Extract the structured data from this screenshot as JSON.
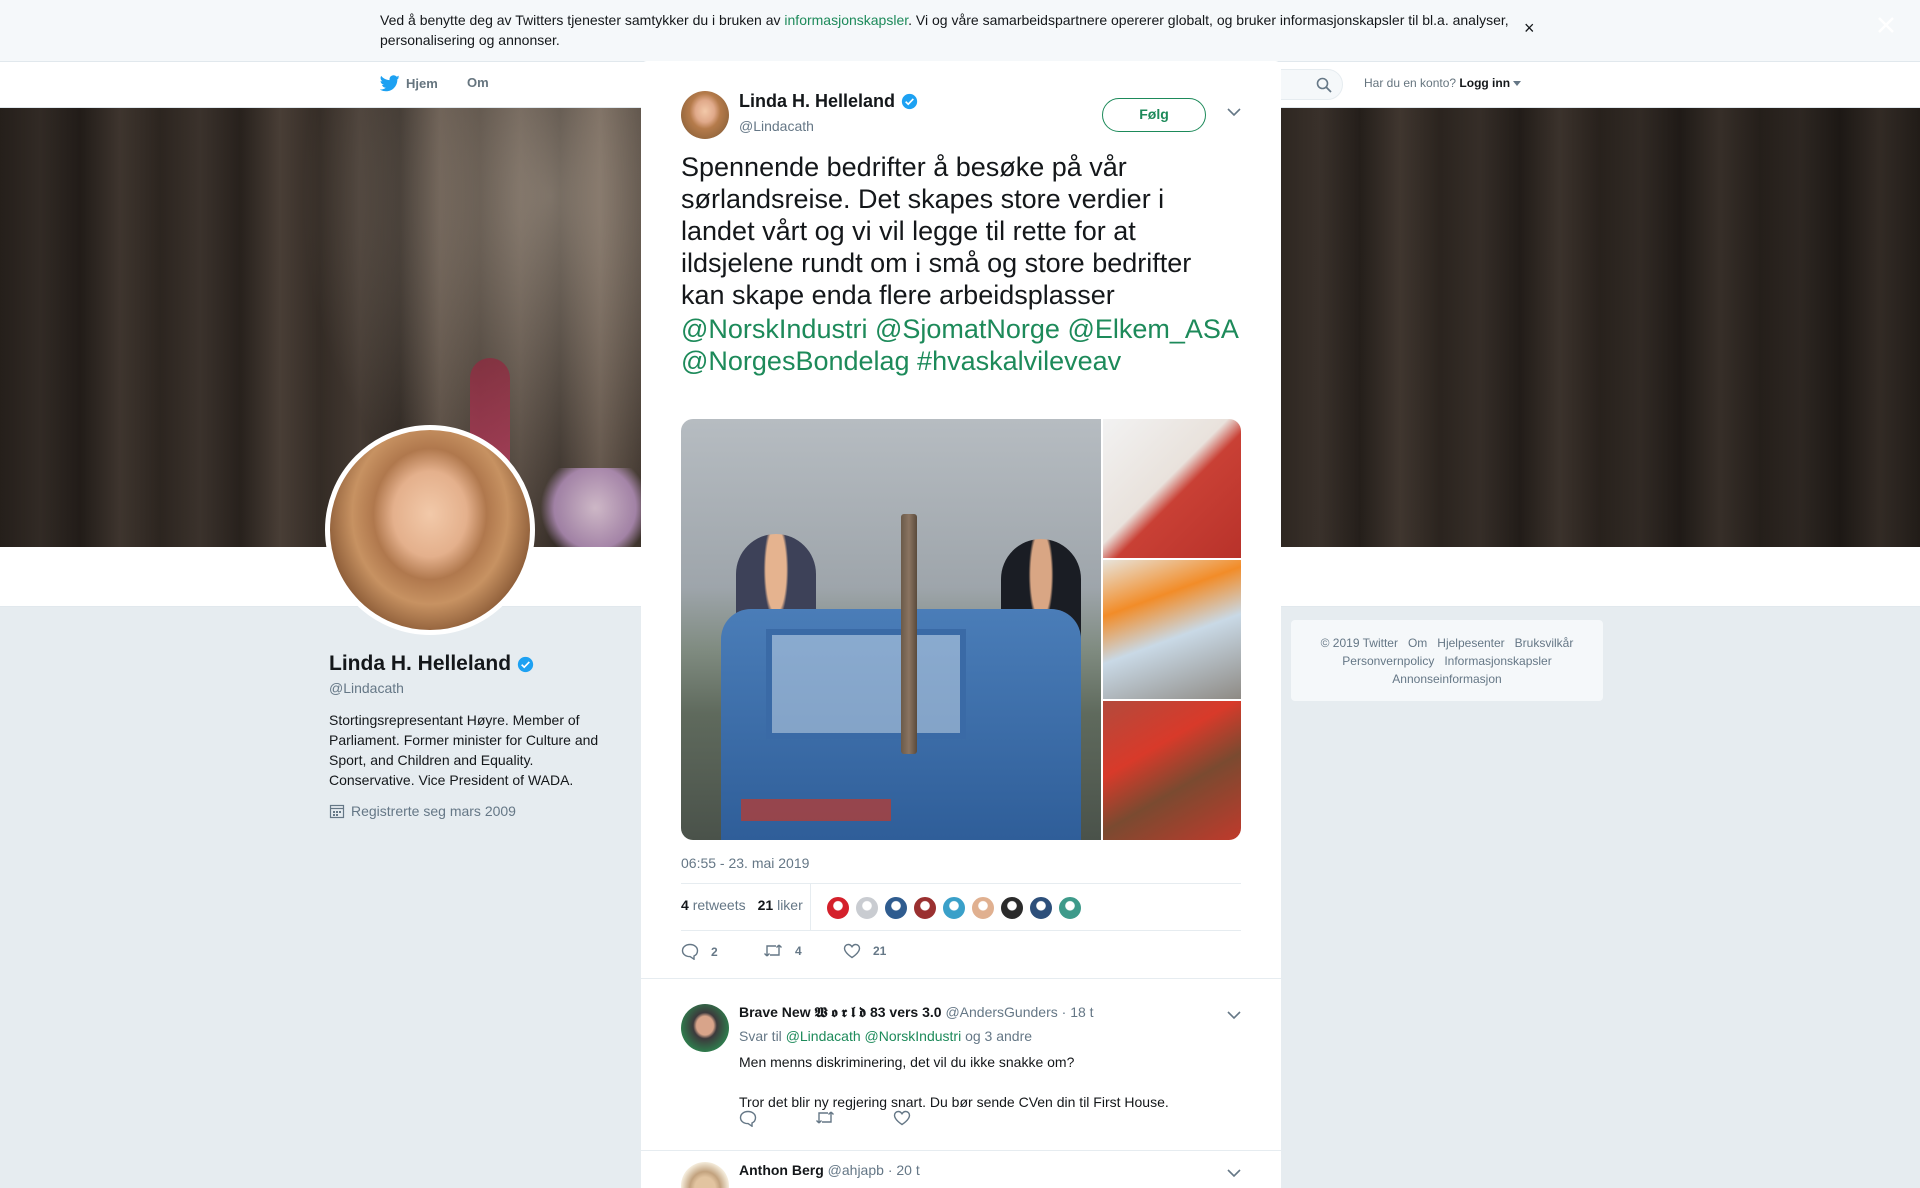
{
  "cookie": {
    "text_before": "Ved å benytte deg av Twitters tjenester samtykker du i bruken av ",
    "link": "informasjonskapsler",
    "text_after": ". Vi og våre samarbeidspartnere opererer globalt, og bruker informasjonskapsler til bl.a. analyser, personalisering og annonser.",
    "close": "×"
  },
  "nav": {
    "home": "Hjem",
    "about": "Om",
    "account_prompt": "Har du en konto?",
    "login": "Logg inn"
  },
  "modal_close": "×",
  "profile": {
    "name": "Linda H. Helleland",
    "handle": "@Lindacath",
    "bio": "Stortingsrepresentant Høyre. Member of Parliament. Former minister for Culture and Sport, and Children and Equality. Conservative. Vice President of WADA.",
    "joined": "Registrerte seg mars 2009"
  },
  "footer": {
    "links": [
      "© 2019 Twitter",
      "Om",
      "Hjelpesenter",
      "Bruksvilkår",
      "Personvernpolicy",
      "Informasjonskapsler",
      "Annonseinformasjon"
    ]
  },
  "tweet": {
    "name": "Linda H. Helleland",
    "handle": "@Lindacath",
    "follow": "Følg",
    "text": "Spennende bedrifter å besøke på vår sørlandsreise. Det skapes store verdier i landet vårt og vi vil legge til rette for at ildsjelene rundt om i små og store bedrifter kan skape enda flere arbeidsplasser",
    "tags": "@NorskIndustri @SjomatNorge @Elkem_ASA @NorgesBondelag #hvaskalvileveav",
    "timestamp": "06:55 - 23. mai 2019",
    "retweets_count": "4",
    "retweets_label": "retweets",
    "likes_count": "21",
    "likes_label": "liker",
    "actions": {
      "replies": "2",
      "retweets": "4",
      "likes": "21"
    },
    "liker_colors": [
      "#d4202b",
      "#c9ccd1",
      "#2f5c8f",
      "#9a3030",
      "#3aa0c9",
      "#e0b090",
      "#2b2b2b",
      "#2d4f7a",
      "#3e9a8a"
    ]
  },
  "replies": [
    {
      "name": "Brave New 𝖂 𝖔 𝖗 𝖑 𝖉 83 vers 3.0",
      "handle": "@AndersGunders",
      "time": "· 18 t",
      "reply_prefix": "Svar til",
      "reply_to": "@Lindacath @NorskIndustri",
      "reply_suffix": "og 3 andre",
      "text1": "Men menns diskriminering, det vil du ikke snakke om?",
      "text2": "Tror det blir ny regjering snart. Du bør sende CVen din til First House."
    },
    {
      "name": "Anthon Berg",
      "handle": "@ahjapb",
      "time": "· 20 t"
    }
  ],
  "colors": {
    "accent": "#1d8a5a",
    "verified": "#1da1f2"
  }
}
